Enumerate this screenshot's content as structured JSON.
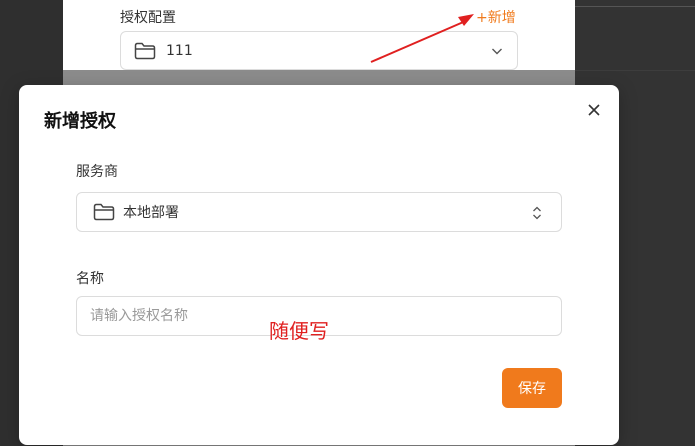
{
  "background_form": {
    "label": "授权配置",
    "add_link": "+新增",
    "selected_value": "111"
  },
  "dialog": {
    "title": "新增授权",
    "provider": {
      "label": "服务商",
      "value": "本地部署"
    },
    "name": {
      "label": "名称",
      "placeholder": "请输入授权名称",
      "value": ""
    },
    "annotation": "随便写",
    "save_label": "保存"
  },
  "icons": [
    "folder-icon",
    "chevron-down-icon",
    "close-icon",
    "select-updown-icon"
  ],
  "colors": {
    "accent": "#f07a1c",
    "annotation": "#e02020"
  }
}
